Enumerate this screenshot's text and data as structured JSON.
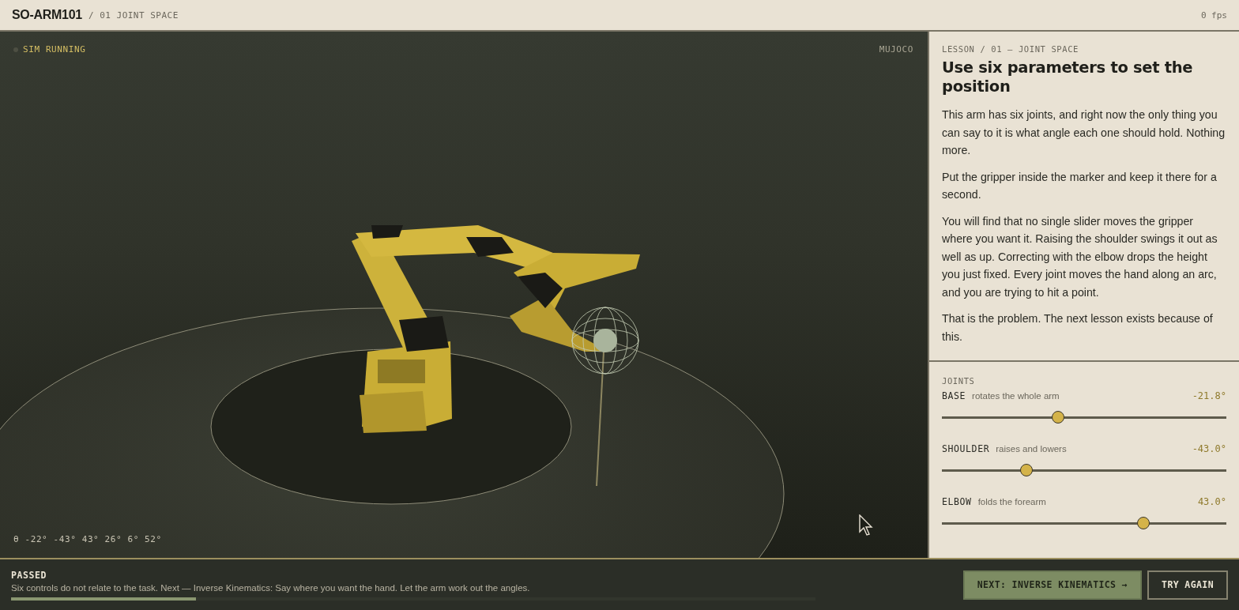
{
  "header": {
    "title": "SO-ARM101",
    "breadcrumb": "/ 01 JOINT SPACE",
    "fps": "0 fps"
  },
  "viewport": {
    "status": "SIM RUNNING",
    "engine": "MUJOCO",
    "angles": "θ -22° -43° 43° 26° 6° 52°"
  },
  "lesson": {
    "eyebrow": "LESSON / 01 — JOINT SPACE",
    "title": "Use six parameters to set the position",
    "paragraphs": [
      "This arm has six joints, and right now the only thing you can say to it is what angle each one should hold. Nothing more.",
      "Put the gripper inside the marker and keep it there for a second.",
      "You will find that no single slider moves the gripper where you want it. Raising the shoulder swings it out as well as up. Correcting with the elbow drops the height you just fixed. Every joint moves the hand along an arc, and you are trying to hit a point.",
      "That is the problem. The next lesson exists because of this."
    ]
  },
  "joints": {
    "heading": "JOINTS",
    "items": [
      {
        "name": "BASE",
        "hint": "rotates the whole arm",
        "reading": "-21.8°",
        "level": 0.407
      },
      {
        "name": "SHOULDER",
        "hint": "raises and lowers",
        "reading": "-43.0°",
        "level": 0.296
      },
      {
        "name": "ELBOW",
        "hint": "folds the forearm",
        "reading": "43.0°",
        "level": 0.709
      }
    ]
  },
  "result": {
    "status": "PASSED",
    "message": "Six controls do not relate to the task. Next — Inverse Kinematics: Say where you want the hand. Let the arm work out the angles.",
    "level": 0.23
  },
  "buttons": [
    {
      "label": "NEXT: INVERSE KINEMATICS →",
      "kind": "primary"
    },
    {
      "label": "TRY AGAIN",
      "kind": "secondary"
    }
  ]
}
